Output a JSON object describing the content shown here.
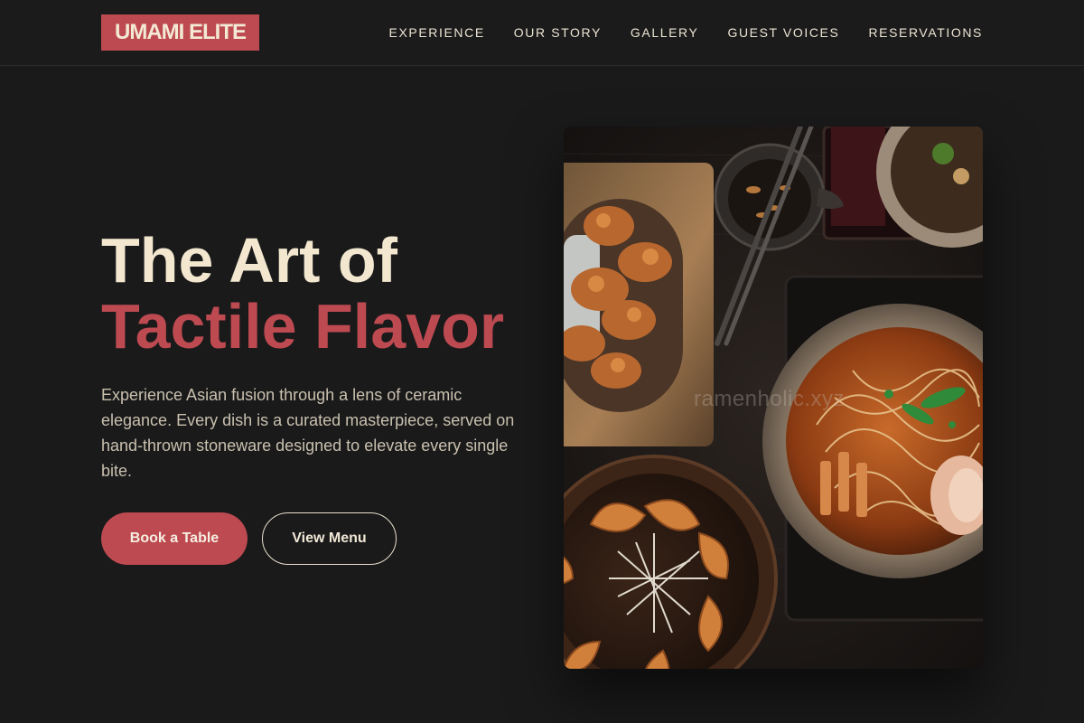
{
  "brand": {
    "logo_text": "UMAMI ELITE",
    "accent_color": "#bd4a50",
    "cream_color": "#f3e8cf"
  },
  "nav": {
    "items": [
      {
        "label": "EXPERIENCE"
      },
      {
        "label": "OUR STORY"
      },
      {
        "label": "GALLERY"
      },
      {
        "label": "GUEST VOICES"
      },
      {
        "label": "RESERVATIONS"
      }
    ]
  },
  "hero": {
    "title_line1": "The Art of",
    "title_line2": "Tactile Flavor",
    "description": "Experience Asian fusion through a lens of ceramic elegance. Every dish is a curated masterpiece, served on hand-thrown stoneware designed to elevate every single bite.",
    "primary_button": "Book a Table",
    "secondary_button": "View Menu",
    "image": {
      "subject": "overhead view of karaage chicken, ramen bowl and gyoza on stoneware",
      "watermark": "ramenholic.xyz"
    }
  }
}
